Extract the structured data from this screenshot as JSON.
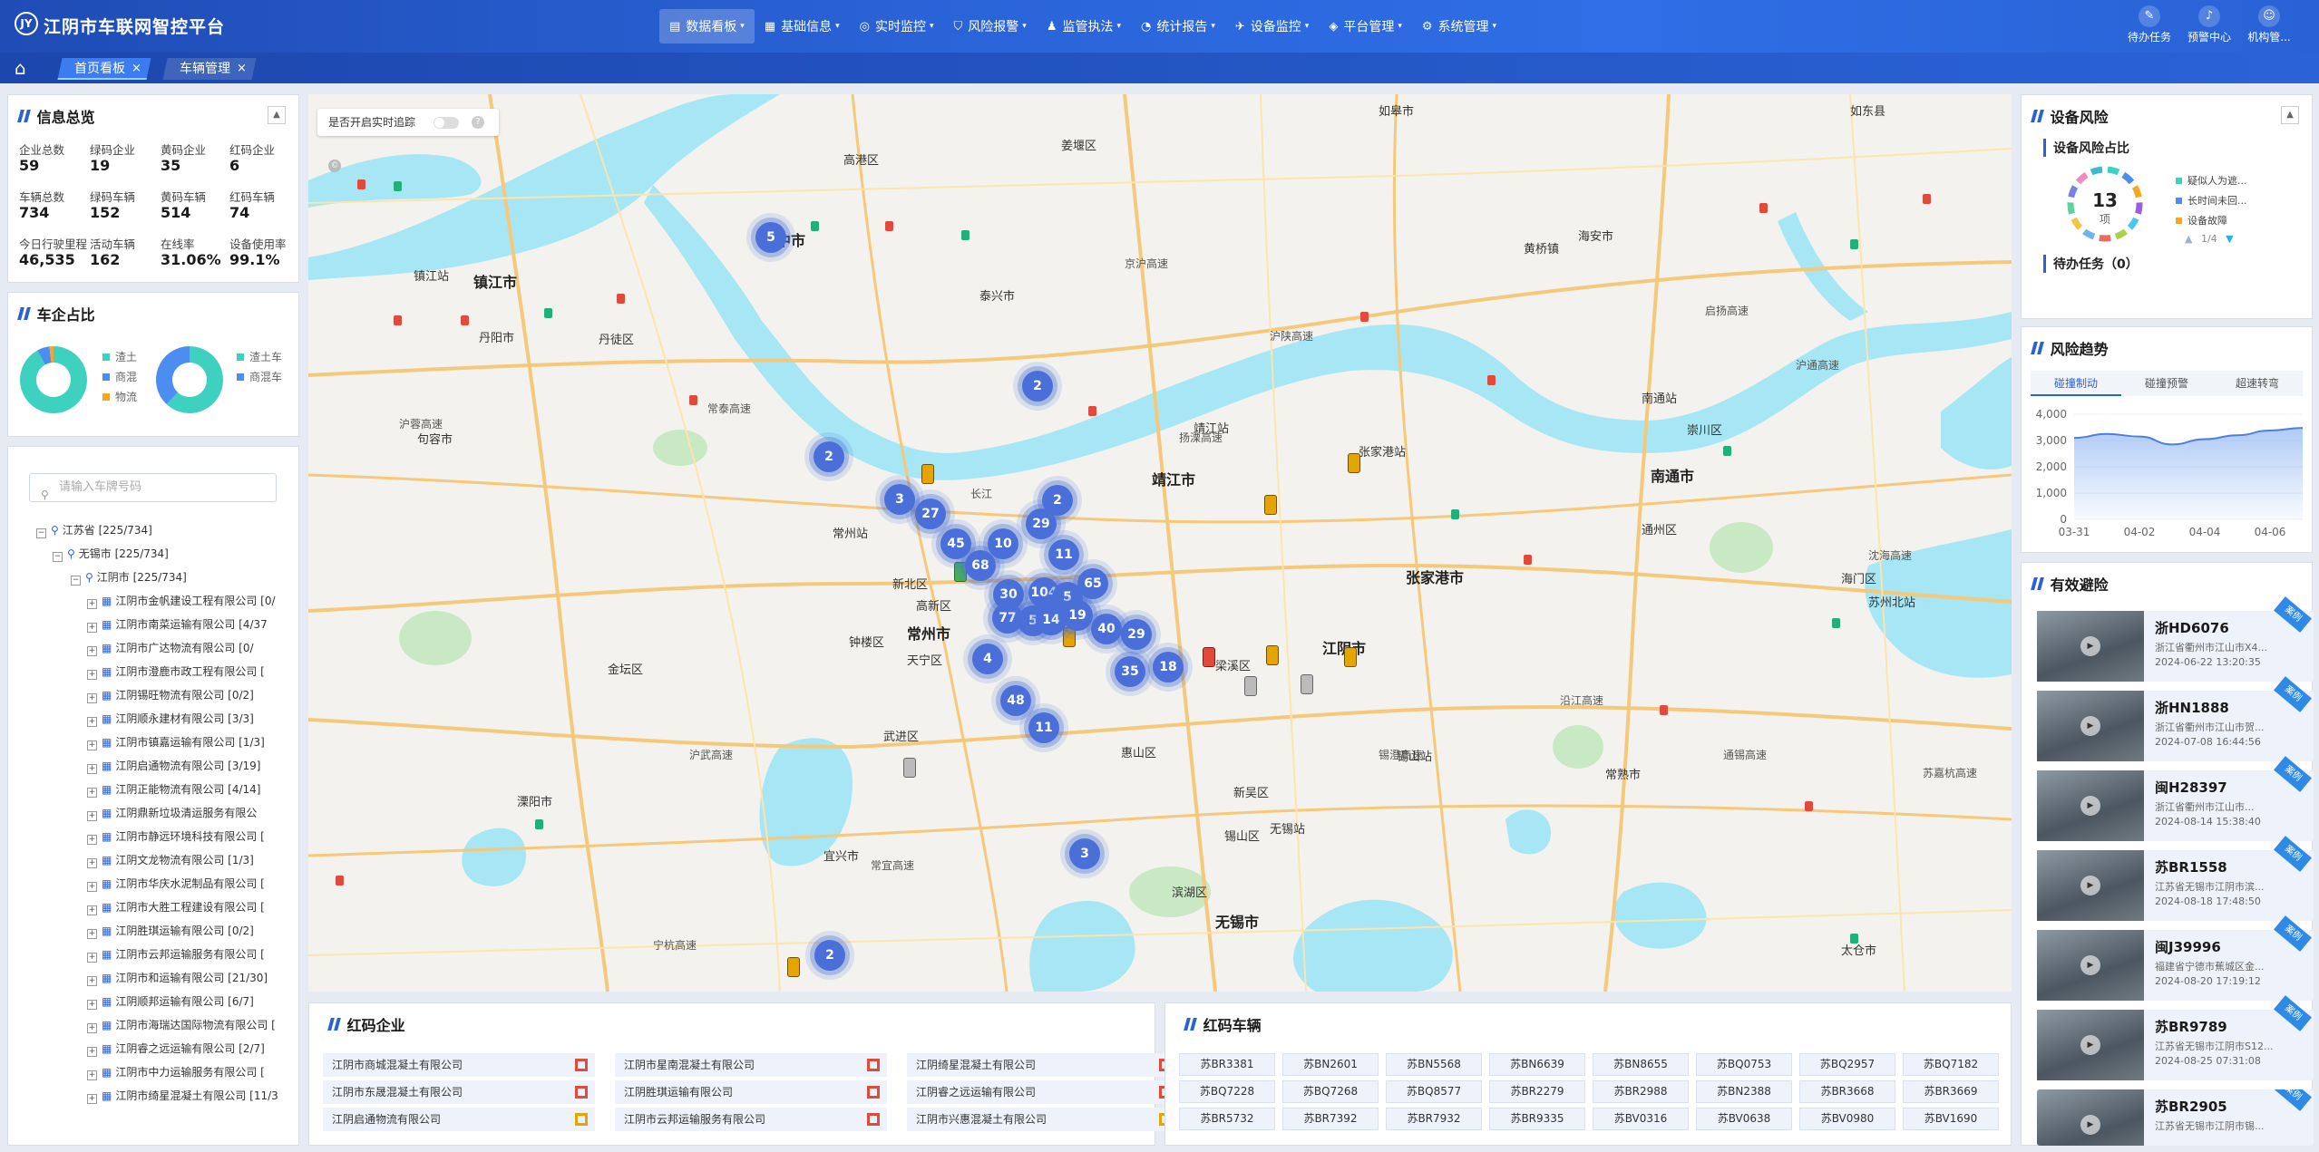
{
  "app": {
    "title": "江阴市车联网智控平台",
    "logo": "JY"
  },
  "nav": [
    {
      "label": "数据看板",
      "icon": "▤",
      "active": true
    },
    {
      "label": "基础信息",
      "icon": "▦"
    },
    {
      "label": "实时监控",
      "icon": "◎"
    },
    {
      "label": "风险报警",
      "icon": "⛉"
    },
    {
      "label": "监管执法",
      "icon": "♟"
    },
    {
      "label": "统计报告",
      "icon": "◔"
    },
    {
      "label": "设备监控",
      "icon": "✈"
    },
    {
      "label": "平台管理",
      "icon": "◈"
    },
    {
      "label": "系统管理",
      "icon": "⚙"
    }
  ],
  "caret": "▾",
  "tools": [
    {
      "label": "待办任务",
      "icon": "✎"
    },
    {
      "label": "预警中心",
      "icon": "♪"
    },
    {
      "label": "机构管...",
      "icon": "☺"
    }
  ],
  "tabs": [
    {
      "label": "首页看板",
      "close": "×"
    },
    {
      "label": "车辆管理",
      "close": "×"
    }
  ],
  "home_icon": "⌂",
  "info": {
    "title": "信息总览",
    "collapse": "▲",
    "stats": [
      [
        {
          "l": "企业总数",
          "v": "59"
        },
        {
          "l": "绿码企业",
          "v": "19"
        },
        {
          "l": "黄码企业",
          "v": "35"
        },
        {
          "l": "红码企业",
          "v": "6"
        }
      ],
      [
        {
          "l": "车辆总数",
          "v": "734"
        },
        {
          "l": "绿码车辆",
          "v": "152"
        },
        {
          "l": "黄码车辆",
          "v": "514"
        },
        {
          "l": "红码车辆",
          "v": "74"
        }
      ],
      [
        {
          "l": "今日行驶里程",
          "v": "46,535"
        },
        {
          "l": "活动车辆",
          "v": "162"
        },
        {
          "l": "在线率",
          "v": "31.06%"
        },
        {
          "l": "设备使用率",
          "v": "99.1%"
        }
      ]
    ]
  },
  "share": {
    "title": "车企占比",
    "pie1": {
      "legend": [
        {
          "label": "渣土",
          "color": "#3fd1c0"
        },
        {
          "label": "商混",
          "color": "#4b8df0"
        },
        {
          "label": "物流",
          "color": "#f5a623"
        }
      ],
      "values": [
        92,
        6,
        2
      ]
    },
    "pie2": {
      "legend": [
        {
          "label": "渣土车",
          "color": "#3fd1c0"
        },
        {
          "label": "商混车",
          "color": "#4b8df0"
        }
      ],
      "values": [
        62,
        38
      ]
    }
  },
  "tree": {
    "search_placeholder": "请输入车牌号码",
    "search_icon": "⚲",
    "province": "江苏省 [225/734]",
    "city": "无锡市 [225/734]",
    "county": "江阴市 [225/734]",
    "expand": "−",
    "plus": "+",
    "node_icon": "⚲",
    "company_icon": "▦",
    "companies": [
      "江阴市金帆建设工程有限公司 [0/",
      "江阴市南菜运输有限公司 [4/37",
      "江阴市广达物流有限公司 [0/",
      "江阴市澄鹿市政工程有限公司 [",
      "江阴锡旺物流有限公司 [0/2]",
      "江阴顺永建材有限公司 [3/3]",
      "江阴市镇嘉运输有限公司 [1/3]",
      "江阴启通物流有限公司 [3/19]",
      "江阴正能物流有限公司 [4/14]",
      "江阴鼎新垃圾清运服务有限公",
      "江阴市静远环境科技有限公司 [",
      "江阴文龙物流有限公司 [1/3]",
      "江阴市华庆水泥制品有限公司 [",
      "江阴市大胜工程建设有限公司 [",
      "江阴胜琪运输有限公司 [0/2]",
      "江阴市云邦运输服务有限公司 [",
      "江阴市和运输有限公司 [21/30]",
      "江阴顺邦运输有限公司 [6/7]",
      "江阴市海瑞达国际物流有限公司 [",
      "江阴睿之远运输有限公司 [2/7]",
      "江阴市中力运输服务有限公司 [",
      "江阴市绮星混凝土有限公司 [11/3"
    ]
  },
  "map": {
    "track_label": "是否开启实时追踪",
    "help": "?",
    "copyright": "©",
    "clusters": [
      "5",
      "2",
      "2",
      "3",
      "27",
      "45",
      "68",
      "10",
      "29",
      "2",
      "11",
      "30",
      "104",
      "5",
      "65",
      "2",
      "77",
      "5",
      "14",
      "19",
      "40",
      "29",
      "4",
      "48",
      "11",
      "35",
      "18",
      "3",
      "2"
    ],
    "labels": [
      "江阴市",
      "镇江市",
      "常州市",
      "无锡市",
      "南通市",
      "张家港市",
      "靖江市",
      "扬中市",
      "丹阳市",
      "新北区",
      "天宁区",
      "钟楼区",
      "武进区",
      "惠山区",
      "锡山区",
      "滨湖区",
      "泰兴市",
      "如皋市",
      "如东县",
      "海门区",
      "崇川区",
      "通州区",
      "太仓市",
      "常熟市",
      "高港区",
      "姜堰区",
      "海安市",
      "金坛区",
      "溧阳市",
      "宜兴市",
      "丹徒区",
      "句容市",
      "新吴区",
      "梁溪区",
      "黄桥镇",
      "高新区",
      "靖江站",
      "张家港站",
      "常州站",
      "无锡站",
      "镇江站",
      "南通站",
      "苏州北站",
      "锡山站"
    ],
    "roads": [
      "沪蓉高速",
      "沪陕高速",
      "京沪高速",
      "沿江高速",
      "常泰高速",
      "锡澄高速",
      "长江",
      "扬溧高速",
      "沪武高速",
      "常宜高速",
      "沈海高速",
      "沪通高速",
      "宁杭高速",
      "通锡高速",
      "苏嘉杭高速",
      "启扬高速"
    ]
  },
  "device": {
    "title": "设备风险",
    "collapse": "▲",
    "sub1": "设备风险占比",
    "count": "13",
    "unit": "项",
    "sub2": "待办任务（0）",
    "legend": [
      {
        "label": "疑似人为遮...",
        "color": "#3fd1c0"
      },
      {
        "label": "长时间未回...",
        "color": "#4b8df0"
      },
      {
        "label": "设备故障",
        "color": "#f5a623"
      }
    ],
    "page": "1/4",
    "prev": "▲",
    "next": "▼",
    "ring_colors": [
      "#3fd1c0",
      "#4b8df0",
      "#f5a623",
      "#9b5de5",
      "#4ac6f0",
      "#a6d34a",
      "#f06a5a",
      "#6fb4f0",
      "#f5c542",
      "#5bd39a",
      "#7a7fe6",
      "#f08ac2",
      "#3fb8d1"
    ]
  },
  "trend": {
    "title": "风险趋势",
    "tabs": [
      "碰撞制动",
      "碰撞预警",
      "超速转弯"
    ],
    "chart_data": {
      "type": "area",
      "x": [
        "03-31",
        "04-01",
        "04-02",
        "04-03",
        "04-04",
        "04-05",
        "04-06",
        "04-07"
      ],
      "series": [
        {
          "values": [
            3100,
            3250,
            3150,
            2850,
            3050,
            3200,
            3380,
            3480
          ]
        }
      ],
      "ylim": [
        0,
        4000
      ],
      "yticks": [
        "4,000",
        "3,000",
        "2,000",
        "1,000",
        "0"
      ],
      "xticks": [
        "03-31",
        "04-02",
        "04-04",
        "04-06"
      ]
    }
  },
  "avoid": {
    "title": "有效避险",
    "badge": "案例",
    "play": "▶",
    "items": [
      {
        "plate": "浙HD6076",
        "addr": "浙江省衢州市江山市X4...",
        "time": "2024-06-22 13:20:35"
      },
      {
        "plate": "浙HN1888",
        "addr": "浙江省衢州市江山市贺...",
        "time": "2024-07-08 16:44:56"
      },
      {
        "plate": "闽H28397",
        "addr": "浙江省衢州市江山市...",
        "time": "2024-08-14 15:38:40"
      },
      {
        "plate": "苏BR1558",
        "addr": "江苏省无锡市江阴市滨...",
        "time": "2024-08-18 17:48:50"
      },
      {
        "plate": "闽J39996",
        "addr": "福建省宁德市蕉城区金...",
        "time": "2024-08-20 17:19:12"
      },
      {
        "plate": "苏BR9789",
        "addr": "江苏省无锡市江阴市S12...",
        "time": "2024-08-25 07:31:08"
      },
      {
        "plate": "苏BR2905",
        "addr": "江苏省无锡市江阴市锡...",
        "time": ""
      }
    ]
  },
  "redent": {
    "title": "红码企业",
    "items": [
      "江阴市商城混凝土有限公司",
      "江阴市星南混凝土有限公司",
      "江阴绮星混凝土有限公司",
      "江阴市东晟混凝土有限公司",
      "江阴胜琪运输有限公司",
      "江阴睿之远运输有限公司",
      "江阴启通物流有限公司",
      "江阴市云邦运输服务有限公司",
      "江阴市兴惠混凝土有限公司"
    ]
  },
  "redveh": {
    "title": "红码车辆",
    "items": [
      "苏BR3381",
      "苏BN2601",
      "苏BN5568",
      "苏BN6639",
      "苏BN8655",
      "苏BQ0753",
      "苏BQ2957",
      "苏BQ7182",
      "苏BQ7228",
      "苏BQ7268",
      "苏BQ8577",
      "苏BR2279",
      "苏BR2988",
      "苏BN2388",
      "苏BR3668",
      "苏BR3669",
      "苏BR5732",
      "苏BR7392",
      "苏BR7932",
      "苏BR9335",
      "苏BV0316",
      "苏BV0638",
      "苏BV0980",
      "苏BV1690"
    ]
  }
}
